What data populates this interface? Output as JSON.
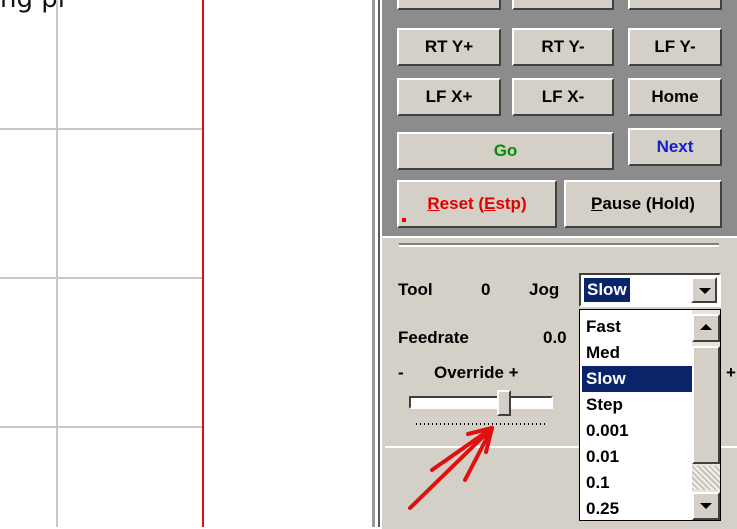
{
  "canvas": {
    "top_text": "ng pi"
  },
  "buttons": {
    "rt_y_plus": "RT Y+",
    "rt_y_minus": "RT Y-",
    "lf_y_minus": "LF Y-",
    "lf_x_plus": "LF X+",
    "lf_x_minus": "LF X-",
    "home": "Home",
    "go": "Go",
    "next": "Next",
    "reset": "Reset (Estp)",
    "pause": "Pause (Hold)"
  },
  "status": {
    "tool_label": "Tool",
    "tool_value": "0",
    "jog_label": "Jog",
    "feedrate_label": "Feedrate",
    "feedrate_value": "0.0",
    "override_minus": "-",
    "override_label": "Override +",
    "override_right": "+"
  },
  "jog_combo": {
    "selected": "Slow",
    "options": [
      "Fast",
      "Med",
      "Slow",
      "Step",
      "0.001",
      "0.01",
      "0.1",
      "0.25"
    ]
  },
  "override_slider": {
    "level": 0.6
  },
  "colors": {
    "go_text": "#0a8a0a",
    "next_text": "#1020d0",
    "reset_text": "#e00000",
    "annotation_arrow": "#e01010",
    "selection": "#0a246a"
  }
}
